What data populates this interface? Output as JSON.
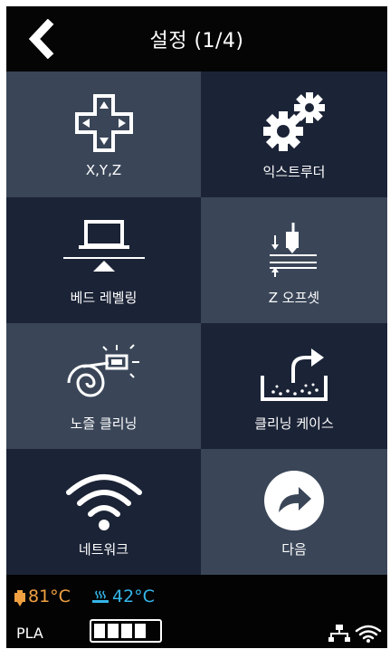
{
  "header": {
    "title": "설정 (1/4)"
  },
  "menu": {
    "items": [
      {
        "label": "X,Y,Z",
        "icon": "directional-pad-icon"
      },
      {
        "label": "익스트루더",
        "icon": "gears-icon"
      },
      {
        "label": "베드 레벨링",
        "icon": "bed-leveling-icon"
      },
      {
        "label": "Z 오프셋",
        "icon": "z-offset-icon"
      },
      {
        "label": "노즐 클리닝",
        "icon": "nozzle-cleaning-icon"
      },
      {
        "label": "클리닝 케이스",
        "icon": "cleaning-case-icon"
      },
      {
        "label": "네트워크",
        "icon": "wifi-icon"
      },
      {
        "label": "다음",
        "icon": "next-arrow-icon"
      }
    ]
  },
  "status": {
    "nozzle_temp": "81°C",
    "bed_temp": "42°C",
    "material": "PLA",
    "battery_level": 1.0
  },
  "colors": {
    "tile_light": "#3a4658",
    "tile_dark": "#1b2336",
    "nozzle_temp": "#f0a040",
    "bed_temp": "#35b6e8"
  }
}
